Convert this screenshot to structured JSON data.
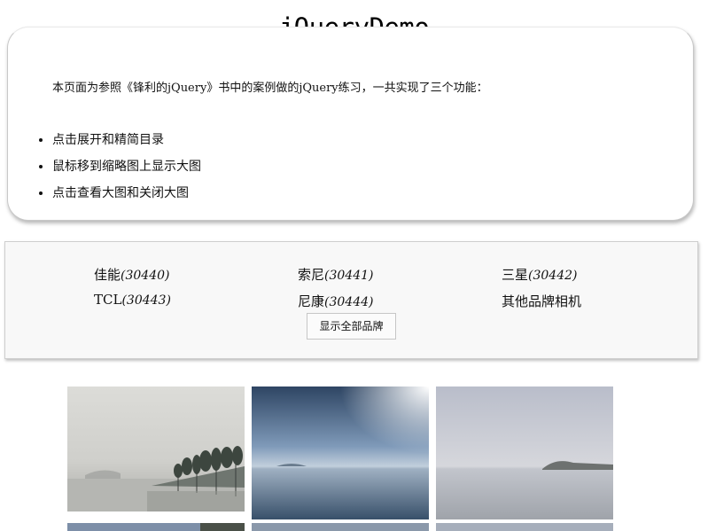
{
  "title": "jQueryDemo",
  "intro": {
    "text": "本页面为参照《锋利的jQuery》书中的案例做的jQuery练习，一共实现了三个功能：",
    "features": [
      "点击展开和精简目录",
      "鼠标移到缩略图上显示大图",
      "点击查看大图和关闭大图"
    ]
  },
  "brands": [
    {
      "name": "佳能",
      "count": "(30440)"
    },
    {
      "name": "索尼",
      "count": "(30441)"
    },
    {
      "name": "三星",
      "count": "(30442)"
    },
    {
      "name": "TCL",
      "count": "(30443)"
    },
    {
      "name": "尼康",
      "count": "(30444)"
    },
    {
      "name": "其他品牌相机",
      "count": ""
    }
  ],
  "show_all_label": "显示全部品牌",
  "thumbnails": [
    {
      "icon": "foggy-lakeshore-photo"
    },
    {
      "icon": "calm-lake-sunlight-photo"
    },
    {
      "icon": "hazy-lake-island-photo"
    },
    {
      "icon": "lake-photo"
    },
    {
      "icon": "lake-photo"
    },
    {
      "icon": "lake-photo"
    }
  ]
}
